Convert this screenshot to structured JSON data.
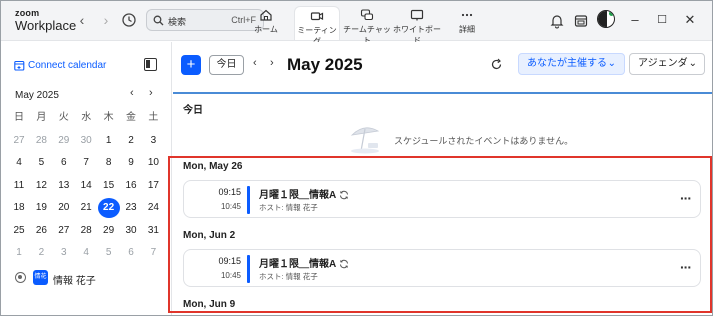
{
  "app": {
    "logo_top": "zoom",
    "logo_bottom": "Workplace",
    "search_placeholder": "検索",
    "search_shortcut": "Ctrl+F",
    "tabs": [
      {
        "label": "ホーム",
        "icon": "home-icon"
      },
      {
        "label": "ミーティング",
        "icon": "video-icon",
        "active": true
      },
      {
        "label": "チームチャット",
        "icon": "chat-icon"
      },
      {
        "label": "ホワイトボード",
        "icon": "whiteboard-icon"
      },
      {
        "label": "詳細",
        "icon": "more-icon"
      }
    ]
  },
  "sidebar": {
    "connect_calendar": "Connect calendar",
    "month_label": "May  2025",
    "weekdays": [
      "日",
      "月",
      "火",
      "水",
      "木",
      "金",
      "土"
    ],
    "weeks": [
      [
        "27",
        "28",
        "29",
        "30",
        "1",
        "2",
        "3"
      ],
      [
        "4",
        "5",
        "6",
        "7",
        "8",
        "9",
        "10"
      ],
      [
        "11",
        "12",
        "13",
        "14",
        "15",
        "16",
        "17"
      ],
      [
        "18",
        "19",
        "20",
        "21",
        "22",
        "23",
        "24"
      ],
      [
        "25",
        "26",
        "27",
        "28",
        "29",
        "30",
        "31"
      ],
      [
        "1",
        "2",
        "3",
        "4",
        "5",
        "6",
        "7"
      ]
    ],
    "today_date": "22",
    "user_badge": "情花",
    "user_name": "情報 花子"
  },
  "toolbar": {
    "add_label": "+",
    "today_label": "今日",
    "prev_label": "‹",
    "next_label": "›",
    "month_title": "May 2025",
    "host_filter": "あなたが主催する",
    "view_select": "アジェンダ"
  },
  "agenda": {
    "today_header": "今日",
    "empty_message": "スケジュールされたイベントはありません。",
    "days": [
      {
        "date": "Mon, May 26",
        "event": {
          "start": "09:15",
          "end": "10:45",
          "title": "月曜１限＿情報A",
          "host": "ホスト: 情報 花子"
        }
      },
      {
        "date": "Mon, Jun 2",
        "event": {
          "start": "09:15",
          "end": "10:45",
          "title": "月曜１限＿情報A",
          "host": "ホスト: 情報 花子"
        }
      },
      {
        "date": "Mon, Jun 9"
      }
    ]
  },
  "colors": {
    "accent": "#0b5cff",
    "highlight_box": "#e0352b",
    "today_divider": "#4a8bd6"
  }
}
